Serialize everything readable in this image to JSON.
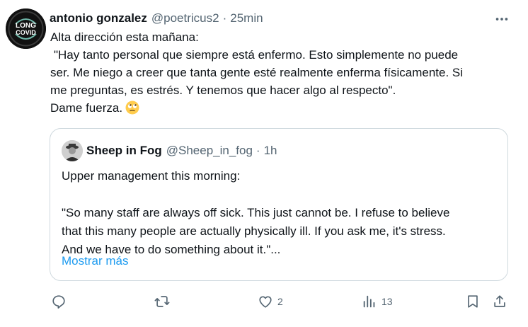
{
  "author": {
    "name": "antonio gonzalez",
    "handle": "@poetricus2",
    "separator": "·",
    "time": "25min",
    "avatar_text": [
      "LONG",
      "COVID"
    ]
  },
  "tweet": {
    "lines": [
      "Alta dirección esta mañana:",
      "\"Hay tanto personal que siempre está enfermo. Esto simplemente no puede",
      "ser. Me niego a creer que tanta gente esté realmente enferma físicamente. Si",
      "me preguntas, es estrés. Y tenemos que hacer algo al respecto\".",
      "Dame fuerza."
    ],
    "emoji": "face-with-rolling-eyes"
  },
  "quote": {
    "name": "Sheep in Fog",
    "handle": "@Sheep_in_fog",
    "separator": "·",
    "time": "1h",
    "lines": [
      "Upper management this morning:",
      "\"So many staff are always off sick. This just cannot be. I refuse to believe",
      "that this many people are actually physically ill. If you ask me, it's stress.",
      "And we have to do something about it.\"..."
    ],
    "show_more": "Mostrar más"
  },
  "actions": {
    "reply": {
      "icon": "reply-icon",
      "count": ""
    },
    "repost": {
      "icon": "repost-icon",
      "count": ""
    },
    "like": {
      "icon": "heart-icon",
      "count": "2"
    },
    "views": {
      "icon": "views-icon",
      "count": "13"
    },
    "bookmark": {
      "icon": "bookmark-icon"
    },
    "share": {
      "icon": "share-icon"
    }
  },
  "colors": {
    "text": "#0f1419",
    "muted": "#536471",
    "link": "#1d9bf0",
    "border": "#cfd9de"
  }
}
